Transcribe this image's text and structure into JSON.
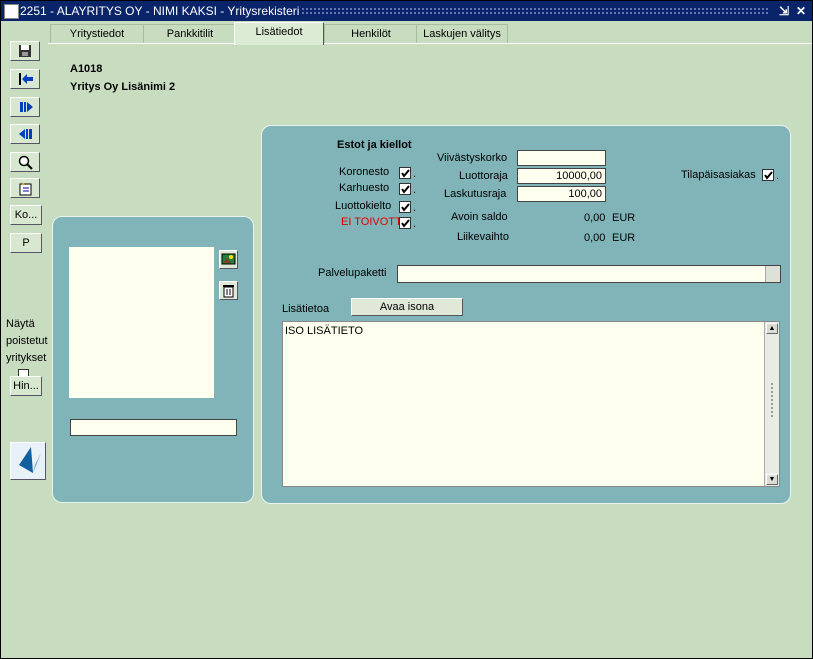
{
  "window": {
    "title": "2251 - ALAYRITYS OY - NIMI KAKSI - Yritysrekisteri",
    "minimize_label": "⇲",
    "close_label": "✕"
  },
  "toolbar": {
    "ko_label": "Ko...",
    "p_label": "P",
    "hin_label": "Hin...",
    "show_deleted_label": "Näytä poistetut yritykset"
  },
  "tabs": [
    {
      "label": "Yritystiedot"
    },
    {
      "label": "Pankkitilit"
    },
    {
      "label": "Lisätiedot"
    },
    {
      "label": "Henkilöt"
    },
    {
      "label": "Laskujen välitys"
    }
  ],
  "record": {
    "id": "A1018",
    "name": "Yritys Oy Lisänimi 2"
  },
  "bans": {
    "heading": "Estot ja kiellot",
    "items": [
      {
        "label": "Koronesto",
        "checked": true
      },
      {
        "label": "Karhuesto",
        "checked": true
      },
      {
        "label": "Luottokielto",
        "checked": true
      },
      {
        "label": "EI TOIVOTTU",
        "checked": true,
        "color": "#e00000"
      }
    ]
  },
  "finance": {
    "viivastyskorko_label": "Viivästyskorko",
    "viivastyskorko_value": "",
    "luottoraja_label": "Luottoraja",
    "luottoraja_value": "10000,00",
    "laskutusraja_label": "Laskutusraja",
    "laskutusraja_value": "100,00",
    "avoin_saldo_label": "Avoin saldo",
    "avoin_saldo_value": "0,00",
    "avoin_saldo_unit": "EUR",
    "liikevaihto_label": "Liikevaihto",
    "liikevaihto_value": "0,00",
    "liikevaihto_unit": "EUR"
  },
  "temporary": {
    "label": "Tilapäisasiakas",
    "checked": true
  },
  "service_package": {
    "label": "Palvelupaketti",
    "value": ""
  },
  "notes": {
    "label": "Lisätietoa",
    "open_button": "Avaa isona",
    "text": "ISO LISÄTIETO"
  },
  "image_panel": {
    "caption_value": ""
  }
}
